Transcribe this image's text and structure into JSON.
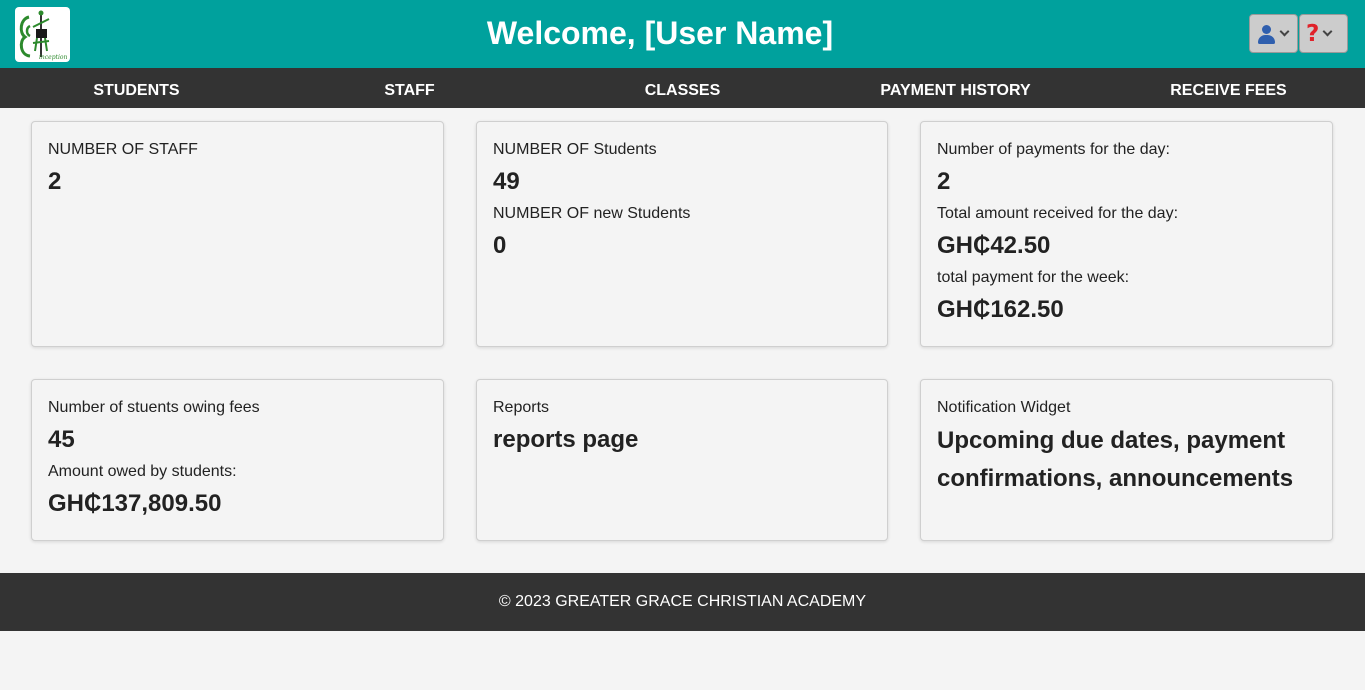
{
  "header": {
    "welcome": "Welcome, [User Name]",
    "background_color": "#00a19d",
    "logo_icon": "school-logo",
    "user_menu_icon": "user-icon",
    "help_menu_icon": "question-mark-icon"
  },
  "nav": {
    "items": [
      {
        "label": "Students"
      },
      {
        "label": "Staff"
      },
      {
        "label": "Classes"
      },
      {
        "label": "Payment History"
      },
      {
        "label": "Receive Fees"
      }
    ],
    "background_color": "#333333"
  },
  "cards": {
    "staff": {
      "label": "NUMBER OF STAFF",
      "value": "2"
    },
    "students": {
      "label": "NUMBER OF Students",
      "value": "49",
      "new_label": "NUMBER OF new Students",
      "new_value": "0"
    },
    "payments": {
      "count_label": "Number of payments for the day:",
      "count_value": "2",
      "day_total_label": "Total amount received for the day:",
      "day_total_value": "GH₵42.50",
      "week_total_label": "total payment for the week:",
      "week_total_value": "GH₵162.50"
    },
    "owing": {
      "count_label": "Number of stuents owing fees",
      "count_value": "45",
      "amount_label": "Amount owed by students:",
      "amount_value": "GH₵137,809.50"
    },
    "reports": {
      "label": "Reports",
      "value": "reports page"
    },
    "notifications": {
      "label": "Notification Widget",
      "value": "Upcoming due dates, payment confirmations, announcements"
    }
  },
  "footer": {
    "text": "© 2023 GREATER GRACE CHRISTIAN ACADEMY"
  }
}
